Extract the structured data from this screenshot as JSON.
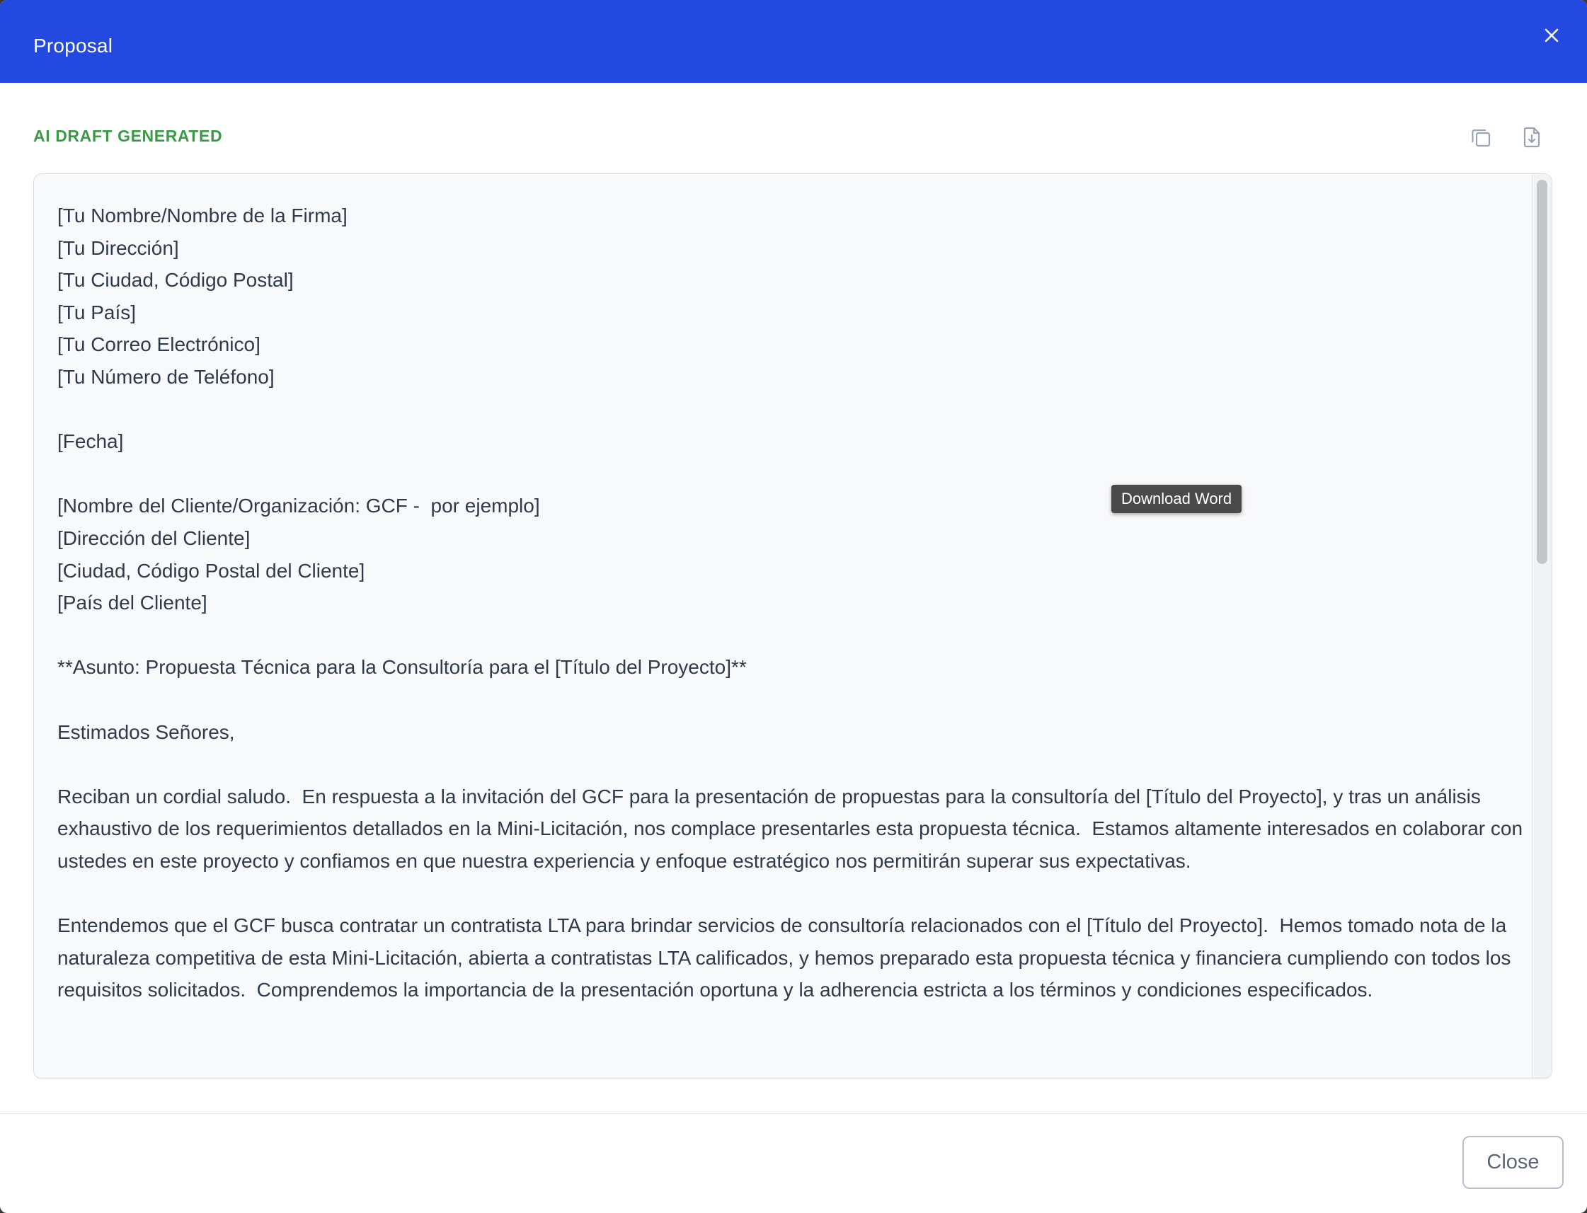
{
  "modal": {
    "title": "Proposal",
    "close_icon": "close-icon"
  },
  "toolbar": {
    "status_label": "AI DRAFT GENERATED",
    "copy_icon": "copy-icon",
    "download_icon": "download-word-icon",
    "download_tooltip": "Download Word"
  },
  "document": {
    "text": "[Tu Nombre/Nombre de la Firma]\n[Tu Dirección]\n[Tu Ciudad, Código Postal]\n[Tu País]\n[Tu Correo Electrónico]\n[Tu Número de Teléfono]\n\n[Fecha]\n\n[Nombre del Cliente/Organización: GCF -  por ejemplo]\n[Dirección del Cliente]\n[Ciudad, Código Postal del Cliente]\n[País del Cliente]\n\n**Asunto: Propuesta Técnica para la Consultoría para el [Título del Proyecto]**\n\nEstimados Señores,\n\nReciban un cordial saludo.  En respuesta a la invitación del GCF para la presentación de propuestas para la consultoría del [Título del Proyecto], y tras un análisis exhaustivo de los requerimientos detallados en la Mini-Licitación, nos complace presentarles esta propuesta técnica.  Estamos altamente interesados en colaborar con ustedes en este proyecto y confiamos en que nuestra experiencia y enfoque estratégico nos permitirán superar sus expectativas.\n\nEntendemos que el GCF busca contratar un contratista LTA para brindar servicios de consultoría relacionados con el [Título del Proyecto].  Hemos tomado nota de la naturaleza competitiva de esta Mini-Licitación, abierta a contratistas LTA calificados, y hemos preparado esta propuesta técnica y financiera cumpliendo con todos los requisitos solicitados.  Comprendemos la importancia de la presentación oportuna y la adherencia estricta a los términos y condiciones especificados."
  },
  "footer": {
    "close_label": "Close"
  },
  "colors": {
    "header": "#2449e0",
    "status_green": "#3b9b45",
    "body_text": "#2f3a4a"
  }
}
